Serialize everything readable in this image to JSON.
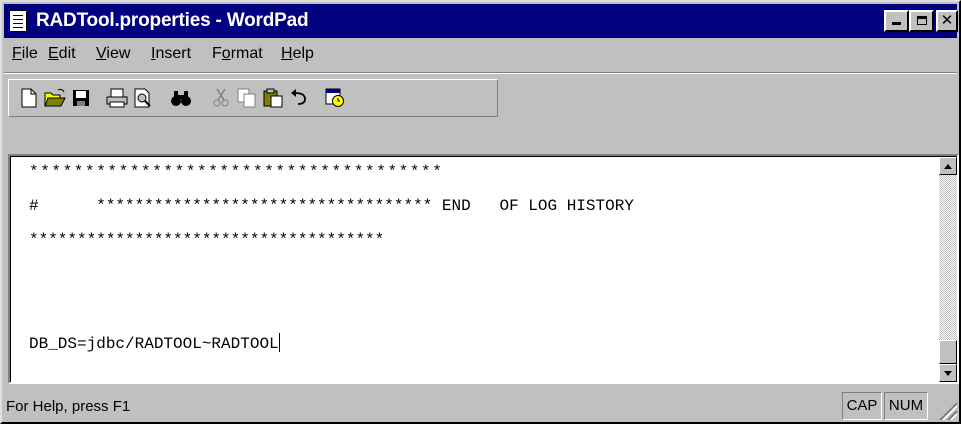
{
  "window": {
    "title": "RADTool.properties - WordPad"
  },
  "menu": [
    {
      "key": "F",
      "rest": "ile"
    },
    {
      "key": "E",
      "rest": "dit"
    },
    {
      "key": "V",
      "rest": "iew"
    },
    {
      "key": "I",
      "rest": "nsert"
    },
    {
      "pre": "F",
      "key": "o",
      "rest": "rmat"
    },
    {
      "key": "H",
      "rest": "elp"
    }
  ],
  "toolbar": {
    "buttons": [
      "new-icon",
      "open-icon",
      "save-icon",
      "print-icon",
      "print-preview-icon",
      "find-icon",
      "cut-icon",
      "copy-icon",
      "paste-icon",
      "undo-icon",
      "insert-datetime-icon"
    ]
  },
  "document": {
    "lines": [
      "*************************************",
      "#      *********************************** END   OF LOG HISTORY",
      "*************************************",
      "",
      "",
      "DB_DS=jdbc/RADTOOL~RADTOOL"
    ]
  },
  "statusbar": {
    "help_text": "For Help, press F1",
    "cap": "CAP",
    "num": "NUM"
  },
  "colors": {
    "titlebar": "#000080",
    "chrome": "#c0c0c0"
  }
}
